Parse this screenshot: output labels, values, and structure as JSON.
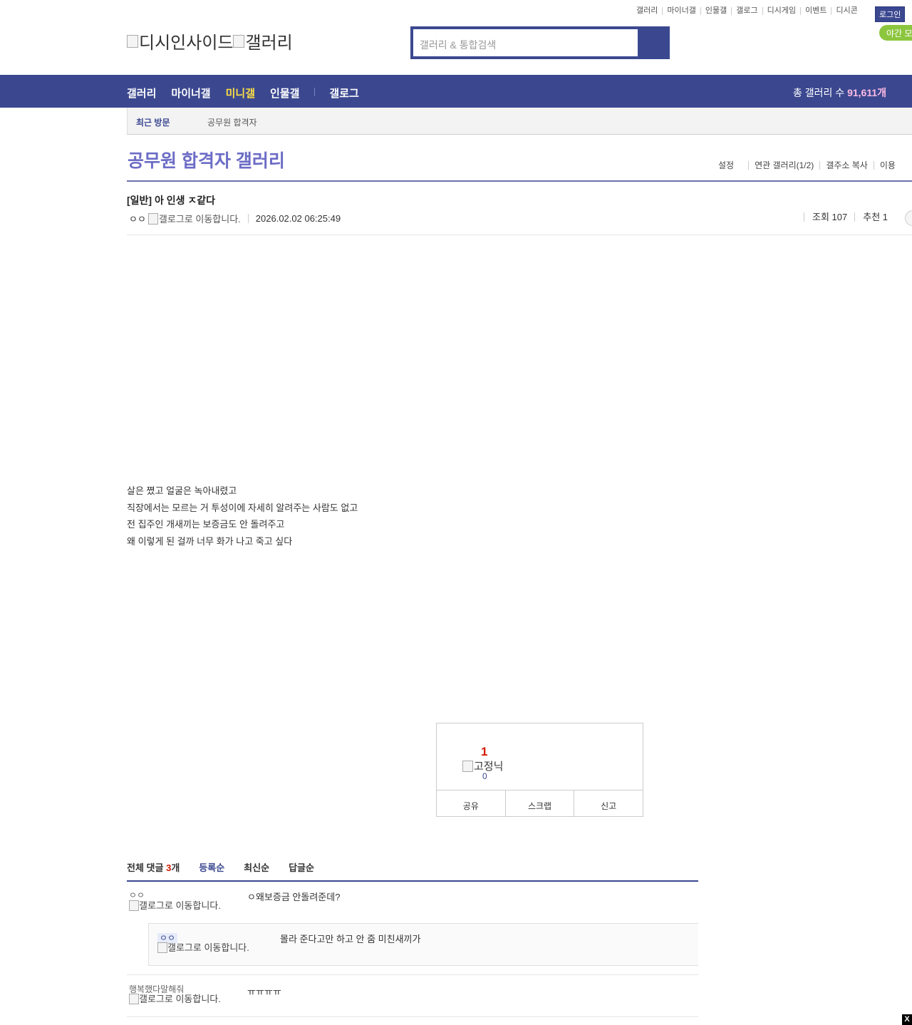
{
  "top_links": [
    "갤러리",
    "마이너갤",
    "인물갤",
    "갤로그",
    "디시게임",
    "이벤트",
    "디시콘"
  ],
  "login_label": "로그인",
  "night_mode_label": "야간 모",
  "logo": {
    "alt1": "디시인사이드",
    "alt2": "갤러리"
  },
  "search": {
    "placeholder": "갤러리 & 통합검색"
  },
  "nav": {
    "items": [
      "갤러리",
      "마이너갤",
      "미니갤",
      "인물갤",
      "갤로그"
    ],
    "active": "미니갤",
    "total_label": "총 갤러리 수",
    "total_value": "91,611개"
  },
  "recent": {
    "label": "최근 방문",
    "gallery": "공무원 합격자"
  },
  "gallery": {
    "title": "공무원 합격자 갤러리",
    "options": [
      "설정",
      "연관 갤러리(1/2)",
      "갤주소 복사",
      "이용"
    ]
  },
  "post": {
    "title": "[일반] 아 인생 ㅈ같다",
    "author": "ㅇㅇ",
    "glog_alt": "갤로그로 이동합니다.",
    "date": "2026.02.02 06:25:49",
    "views": "조회 107",
    "recommend": "추천 1",
    "body": [
      "살은 쪘고 얼굴은 녹아내렸고",
      "직장에서는 모르는 거 투성이에 자세히 알려주는 사람도 없고",
      "전 집주인 개새끼는 보증금도 안 돌려주고",
      "왜 이렇게 된 걸까 너무 화가 나고 죽고 싶다"
    ]
  },
  "recommend_box": {
    "up_count": "1",
    "fixed_nick_alt": "고정닉",
    "down_count": "0",
    "buttons": [
      "공유",
      "스크랩",
      "신고"
    ]
  },
  "comments": {
    "header_prefix": "전체 댓글",
    "count": "3",
    "count_suffix": "개",
    "sorts": [
      "등록순",
      "최신순",
      "답글순"
    ],
    "items": [
      {
        "nick": "ㅇㅇ",
        "glog_alt": "갤로그로 이동합니다.",
        "text": "ㅇ왜보증금 안돌려준데?"
      },
      {
        "nick": "ㅇㅇ",
        "glog_alt": "갤로그로 이동합니다.",
        "text": "몰라 준다고만 하고 안 줌 미친새끼가"
      },
      {
        "nick": "행복했다말해줘",
        "glog_alt": "갤로그로 이동합니다.",
        "text": "ㅠㅠㅠㅠ"
      }
    ]
  },
  "close_label": "X",
  "colors": {
    "brand": "#3b4890",
    "gallery_title": "#6c6cc6",
    "active_nav": "#ffdf42",
    "count_red": "#d31900",
    "night_green": "#8cc63e"
  }
}
